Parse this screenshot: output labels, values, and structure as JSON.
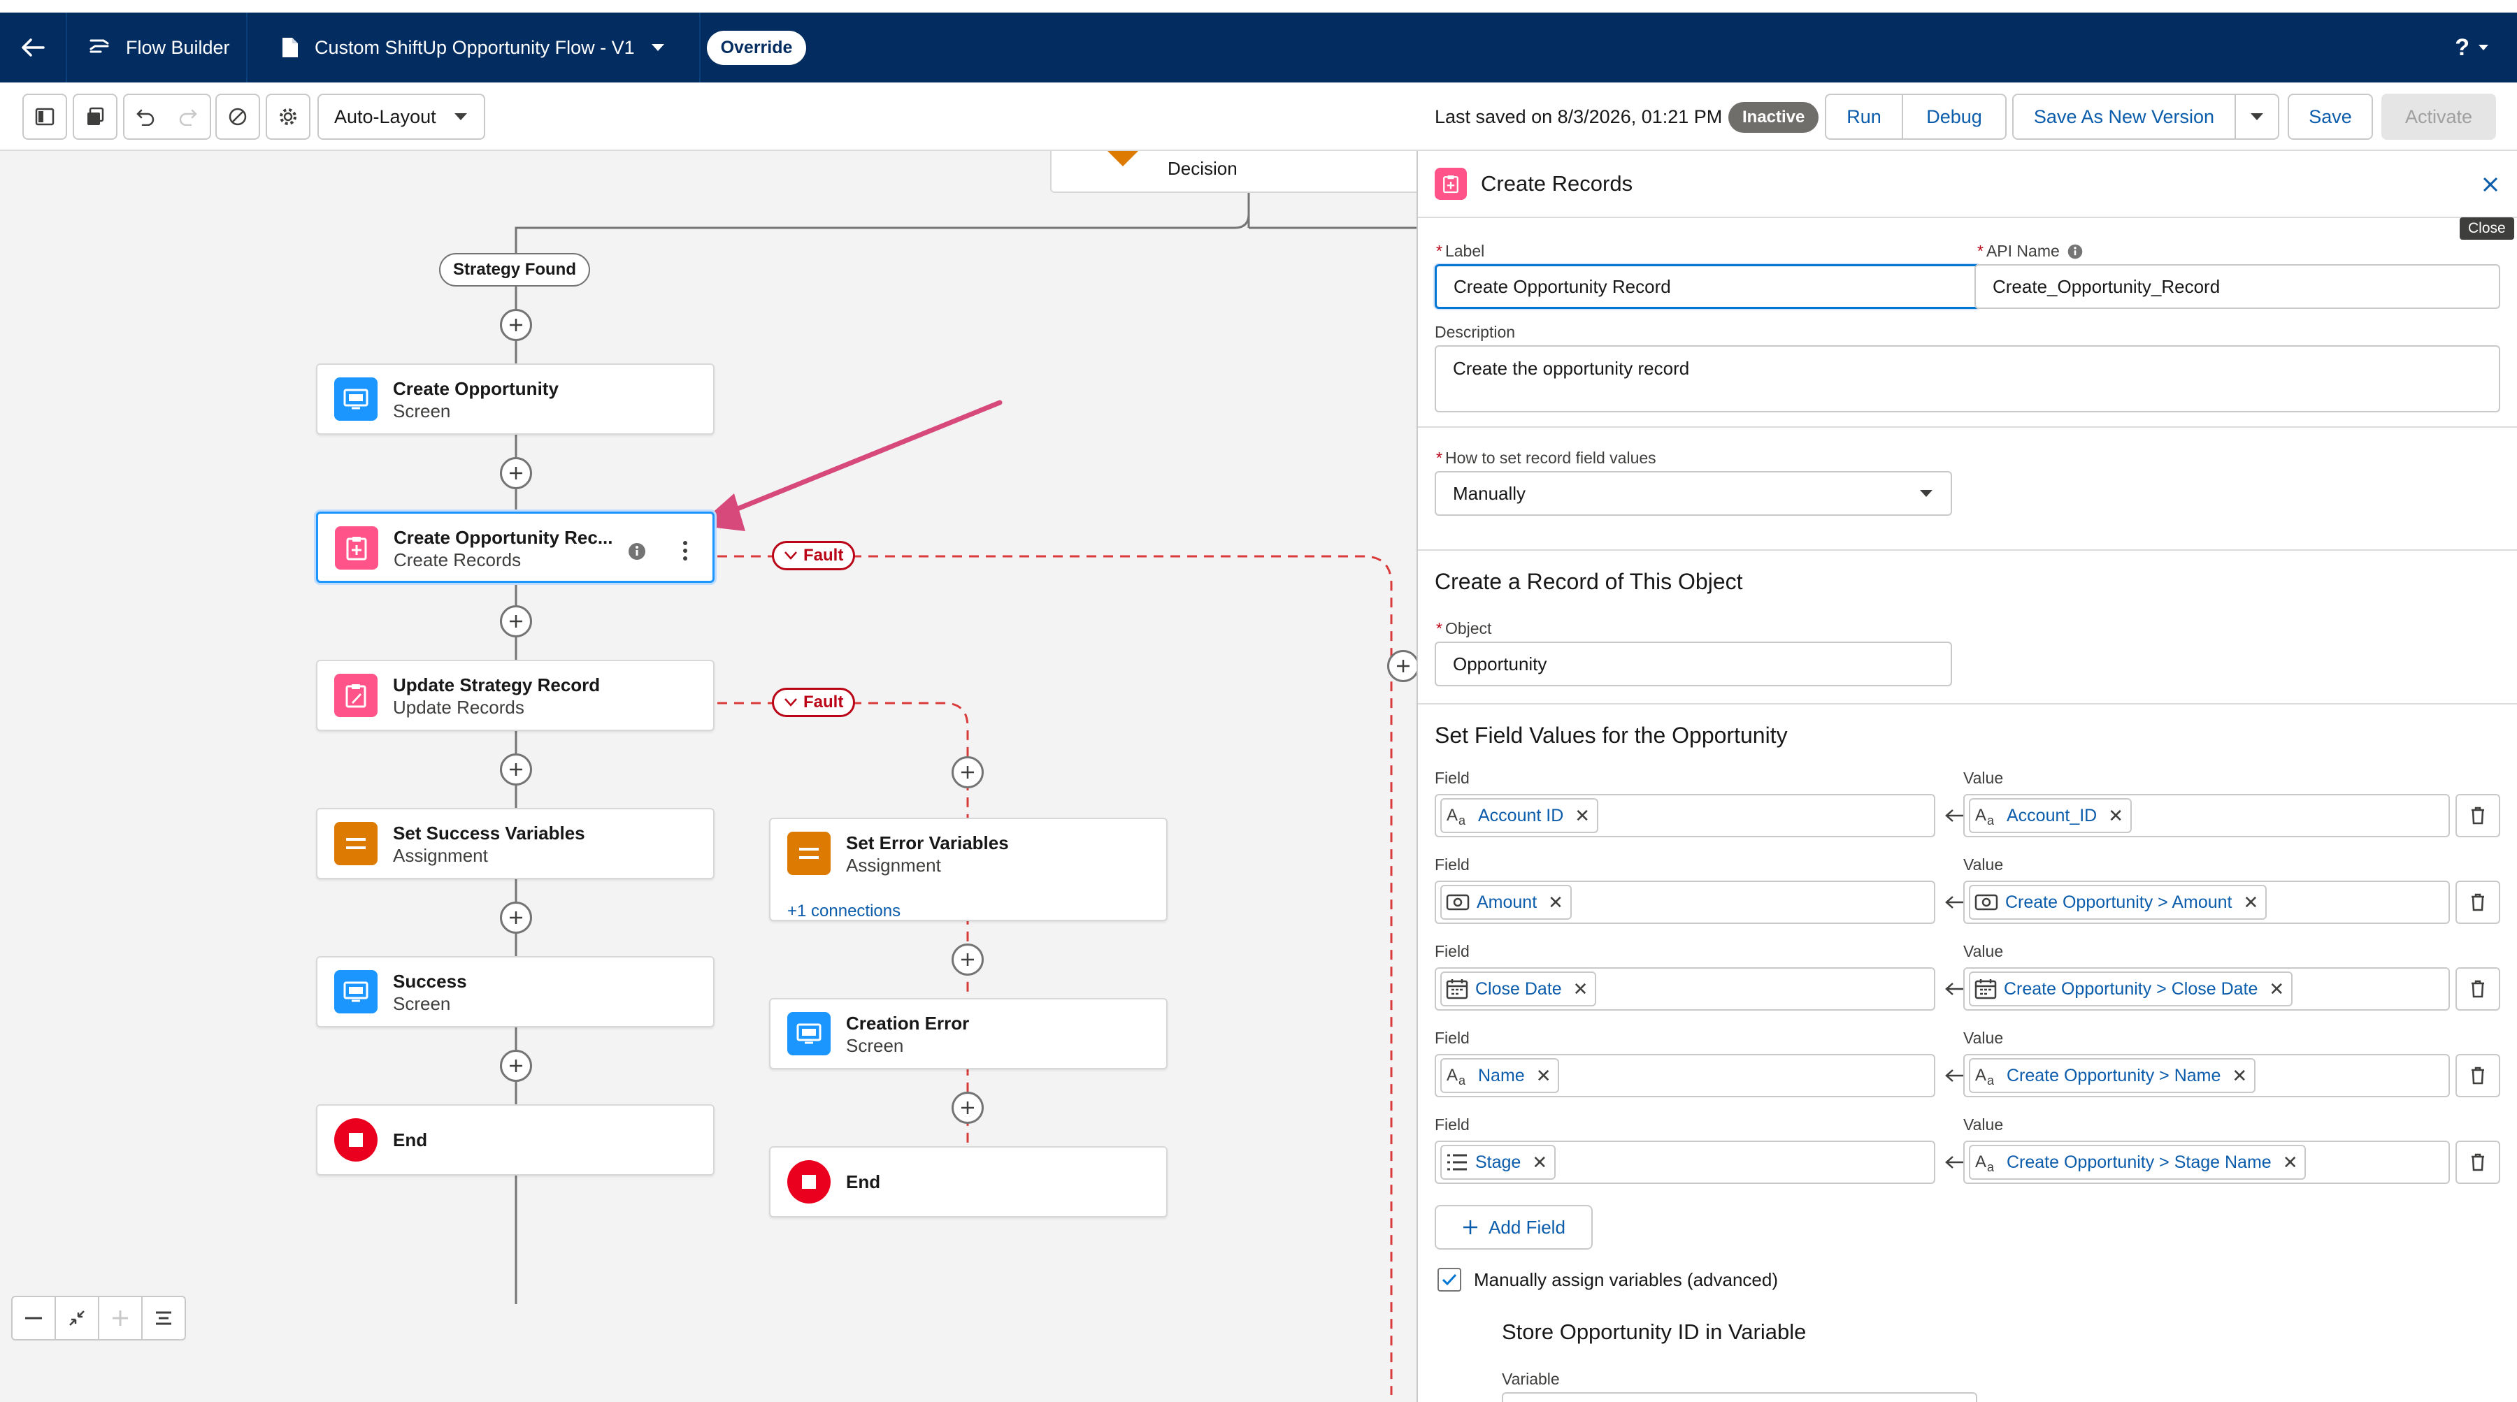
{
  "header": {
    "app_name": "Flow Builder",
    "flow_name": "Custom ShiftUp Opportunity Flow - V1",
    "override_label": "Override",
    "help_label": "?"
  },
  "toolbar": {
    "layout_mode": "Auto-Layout",
    "last_saved": "Last saved on 8/3/2026, 01:21 PM",
    "status_badge": "Inactive",
    "run_label": "Run",
    "debug_label": "Debug",
    "save_new_version_label": "Save As New Version",
    "save_label": "Save",
    "activate_label": "Activate"
  },
  "canvas": {
    "decision_label": "Decision",
    "outcome_label": "Strategy Found",
    "fault_label": "Fault",
    "nodes": [
      {
        "title": "Create Opportunity",
        "subtitle": "Screen"
      },
      {
        "title": "Create Opportunity Rec...",
        "subtitle": "Create Records"
      },
      {
        "title": "Update Strategy Record",
        "subtitle": "Update Records"
      },
      {
        "title": "Set Success Variables",
        "subtitle": "Assignment"
      },
      {
        "title": "Success",
        "subtitle": "Screen"
      },
      {
        "title": "End",
        "subtitle": ""
      },
      {
        "title": "Set Error Variables",
        "subtitle": "Assignment",
        "link": "+1 connections"
      },
      {
        "title": "Creation Error",
        "subtitle": "Screen"
      },
      {
        "title": "End",
        "subtitle": ""
      }
    ]
  },
  "panel": {
    "title": "Create Records",
    "close_tooltip": "Close",
    "label_label": "Label",
    "label_value": "Create Opportunity Record",
    "api_name_label": "API Name",
    "api_name_value": "Create_Opportunity_Record",
    "description_label": "Description",
    "description_value": "Create the opportunity record",
    "how_to_set_label": "How to set record field values",
    "how_to_set_value": "Manually",
    "object_section_title": "Create a Record of This Object",
    "object_label": "Object",
    "object_value": "Opportunity",
    "field_values_title": "Set Field Values for the Opportunity",
    "field_col_label": "Field",
    "value_col_label": "Value",
    "rows": [
      {
        "field": "Account ID",
        "field_icon": "text-icon",
        "value": "Account_ID",
        "value_icon": "text-icon"
      },
      {
        "field": "Amount",
        "field_icon": "currency-icon",
        "value": "Create Opportunity > Amount",
        "value_icon": "currency-icon"
      },
      {
        "field": "Close Date",
        "field_icon": "calendar-icon",
        "value": "Create Opportunity > Close Date",
        "value_icon": "calendar-icon"
      },
      {
        "field": "Name",
        "field_icon": "text-icon",
        "value": "Create Opportunity > Name",
        "value_icon": "text-icon"
      },
      {
        "field": "Stage",
        "field_icon": "picklist-icon",
        "value": "Create Opportunity > Stage Name",
        "value_icon": "text-icon"
      }
    ],
    "add_field_label": "Add Field",
    "manual_assign_label": "Manually assign variables (advanced)",
    "store_id_title": "Store Opportunity ID in Variable",
    "variable_label": "Variable"
  },
  "colors": {
    "header_bg": "#032d60",
    "brand_blue": "#0176d3",
    "fault_red": "#ba0517",
    "annotation_arrow": "#d6497a"
  }
}
